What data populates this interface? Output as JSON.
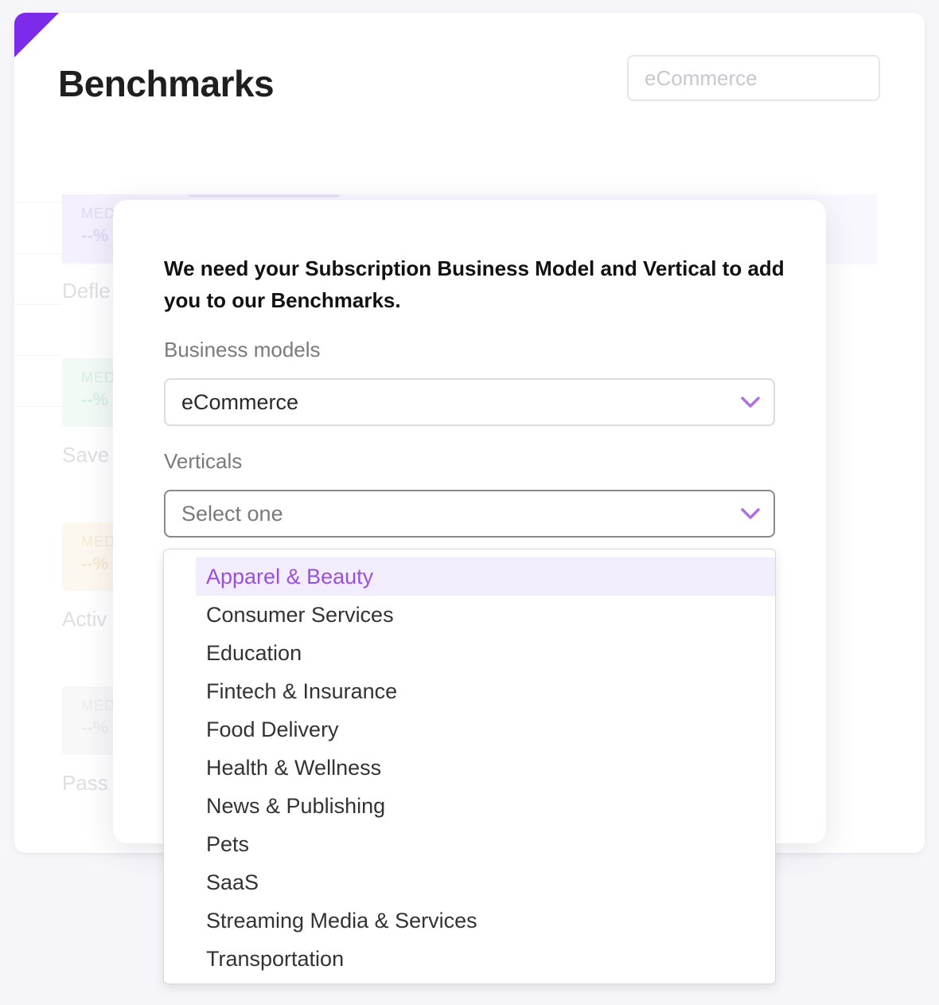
{
  "page": {
    "title": "Benchmarks",
    "top_select_value": "eCommerce"
  },
  "background_metrics": [
    {
      "label": "MED",
      "value": "--%",
      "caption": "Defle",
      "tint": "#e7dcfb",
      "text_color": "#b79be8"
    },
    {
      "label": "MED",
      "value": "--%",
      "caption": "Save",
      "tint": "#dff3ea",
      "text_color": "#9cd3bc"
    },
    {
      "label": "MED",
      "value": "--%",
      "caption": "Activ",
      "tint": "#fbefd9",
      "text_color": "#e7c995"
    },
    {
      "label": "MED",
      "value": "--%",
      "caption": "Pass",
      "tint": "#f0f0f2",
      "text_color": "#d0d0d6"
    }
  ],
  "modal": {
    "heading": "We need your Subscription Business Model and Vertical to add you to our Benchmarks.",
    "business_models": {
      "label": "Business models",
      "value": "eCommerce"
    },
    "verticals": {
      "label": "Verticals",
      "placeholder": "Select one",
      "highlighted_index": 0,
      "options": [
        "Apparel & Beauty",
        "Consumer Services",
        "Education",
        "Fintech & Insurance",
        "Food Delivery",
        "Health & Wellness",
        "News & Publishing",
        "Pets",
        "SaaS",
        "Streaming Media & Services",
        "Transportation"
      ]
    }
  },
  "colors": {
    "accent": "#7c2bea",
    "chevron": "#b06fe0",
    "highlight_bg": "#f1edfd",
    "highlight_text": "#9b4fe0"
  },
  "icons": {
    "select_arrow": "chevron-down-icon"
  }
}
